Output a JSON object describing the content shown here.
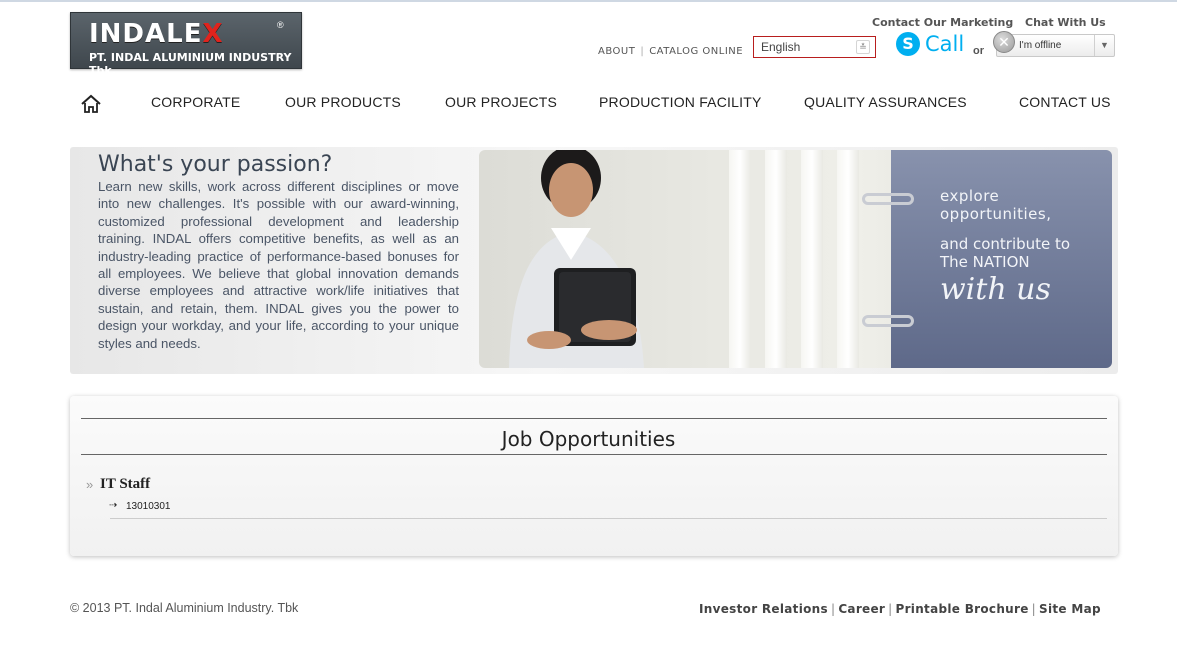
{
  "brand": {
    "logo_main": "INDALE",
    "logo_x": "X",
    "logo_reg": "®",
    "company_sub": "PT. INDAL ALUMINIUM INDUSTRY Tbk."
  },
  "header": {
    "contact_marketing": "Contact Our Marketing",
    "chat": "Chat With Us",
    "about": "ABOUT",
    "catalog": "CATALOG ONLINE",
    "link_separator": "|",
    "language": "English",
    "call_label": "Call",
    "or_label": "or",
    "status_text": "I'm offline"
  },
  "nav": {
    "items": [
      "CORPORATE",
      "OUR PRODUCTS",
      "OUR PROJECTS",
      "PRODUCTION FACILITY",
      "QUALITY ASSURANCES",
      "CONTACT US"
    ]
  },
  "hero": {
    "title": "What's your passion?",
    "body": "Learn new skills, work across different disciplines or move into new challenges. It's possible with our award-winning, customized professional development and leadership training. INDAL offers competitive benefits, as well as an industry-leading practice of performance-based bonuses for all employees. We believe that global innovation demands diverse employees and attractive work/life initiatives that sustain, and retain, them. INDAL gives you the power to design your workday, and your life, according to your unique styles and needs.",
    "panel_line1": "explore",
    "panel_line2": "opportunities,",
    "panel_line3": "and contribute to",
    "panel_line4": "The NATION",
    "panel_line5": "with us"
  },
  "jobs": {
    "title": "Job Opportunities",
    "bullet": "»",
    "items": [
      {
        "name": "IT Staff",
        "arrow": "⇢",
        "code": "13010301"
      }
    ]
  },
  "footer": {
    "copyright": "© 2013 PT. Indal Aluminium Industry. Tbk",
    "links": [
      "Investor Relations",
      "Career",
      "Printable Brochure",
      "Site Map"
    ],
    "separator": "|"
  },
  "icons": {
    "home": "home-icon",
    "skype": "skype-icon",
    "offline": "offline-status-icon",
    "dropdown": "chevron-down-icon"
  },
  "colors": {
    "brand_red": "#e0231d",
    "skype_blue": "#00aff0",
    "panel_blue": "#6a7594"
  }
}
